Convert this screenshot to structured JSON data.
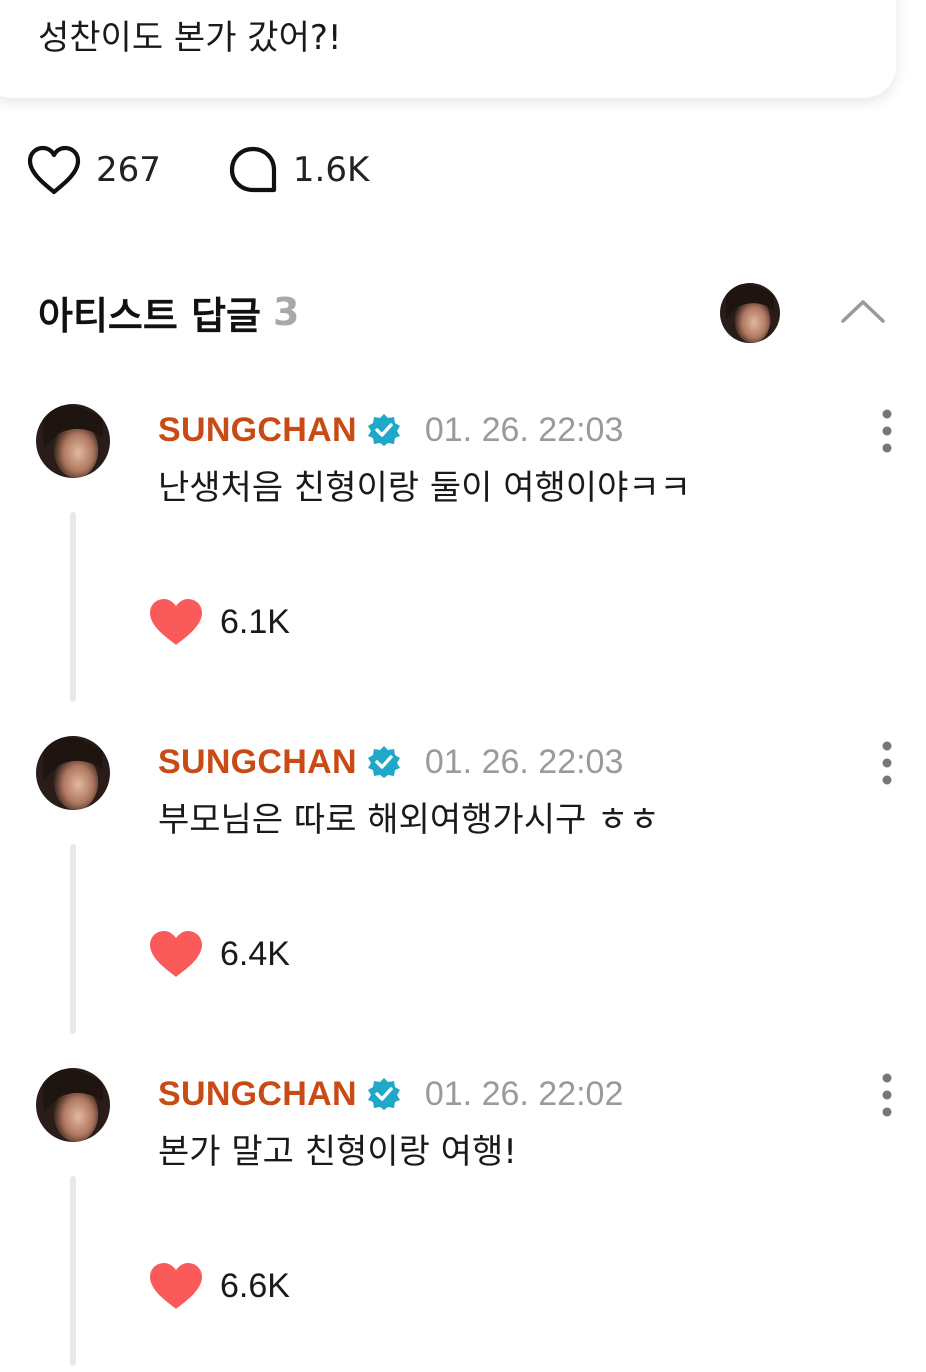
{
  "post": {
    "text": "성찬이도 본가 갔어?!",
    "likes": "267",
    "comments": "1.6K"
  },
  "artist_replies": {
    "title": "아티스트 답글",
    "count": "3",
    "comments": [
      {
        "author": "SUNGCHAN",
        "time": "01. 26. 22:03",
        "text": "난생처음 친형이랑 둘이 여행이야ㅋㅋ",
        "likes": "6.1K"
      },
      {
        "author": "SUNGCHAN",
        "time": "01. 26. 22:03",
        "text": "부모님은 따로 해외여행가시구 ㅎㅎ",
        "likes": "6.4K"
      },
      {
        "author": "SUNGCHAN",
        "time": "01. 26. 22:02",
        "text": "본가 말고 친형이랑 여행!",
        "likes": "6.6K"
      }
    ]
  },
  "colors": {
    "author_name": "#c84a14",
    "verified_badge": "#20a8c8",
    "like_heart": "#fa5a5a",
    "timestamp": "#9a9a9a",
    "reply_count": "#a8a8a8"
  },
  "icons": {
    "like": "heart-outline-icon",
    "comment": "speech-bubble-icon",
    "collapse": "chevron-up-icon",
    "verified": "verified-badge-icon",
    "more": "more-vertical-icon",
    "liked": "heart-filled-icon"
  }
}
